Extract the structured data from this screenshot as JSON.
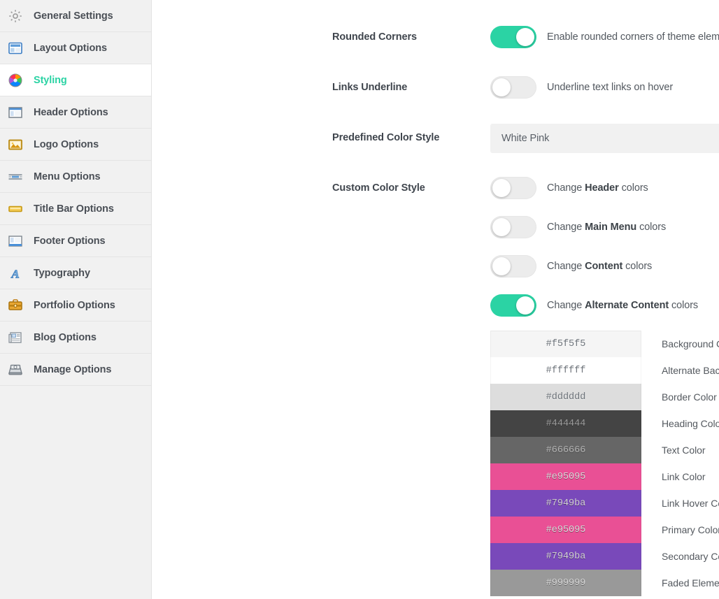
{
  "sidebar": {
    "items": [
      {
        "label": "General Settings",
        "icon": "gear-icon",
        "active": false
      },
      {
        "label": "Layout Options",
        "icon": "layout-icon",
        "active": false
      },
      {
        "label": "Styling",
        "icon": "color-wheel-icon",
        "active": true
      },
      {
        "label": "Header Options",
        "icon": "header-layout-icon",
        "active": false
      },
      {
        "label": "Logo Options",
        "icon": "image-icon",
        "active": false
      },
      {
        "label": "Menu Options",
        "icon": "menu-lines-icon",
        "active": false
      },
      {
        "label": "Title Bar Options",
        "icon": "title-bar-icon",
        "active": false
      },
      {
        "label": "Footer Options",
        "icon": "footer-layout-icon",
        "active": false
      },
      {
        "label": "Typography",
        "icon": "letter-a-icon",
        "active": false
      },
      {
        "label": "Portfolio Options",
        "icon": "briefcase-icon",
        "active": false
      },
      {
        "label": "Blog Options",
        "icon": "newspaper-icon",
        "active": false
      },
      {
        "label": "Manage Options",
        "icon": "disk-drive-icon",
        "active": false
      }
    ]
  },
  "main": {
    "rounded_corners": {
      "label": "Rounded Corners",
      "toggle_on": true,
      "description": "Enable rounded corners of theme elements"
    },
    "links_underline": {
      "label": "Links Underline",
      "toggle_on": false,
      "description": "Underline text links on hover"
    },
    "predefined_color_style": {
      "label": "Predefined Color Style",
      "value": "White Pink",
      "chevron": "chevron-down-icon"
    },
    "custom_color_style": {
      "label": "Custom Color Style",
      "toggles": [
        {
          "prefix": "Change ",
          "strong": "Header",
          "suffix": " colors",
          "on": false
        },
        {
          "prefix": "Change ",
          "strong": "Main Menu",
          "suffix": " colors",
          "on": false
        },
        {
          "prefix": "Change ",
          "strong": "Content",
          "suffix": " colors",
          "on": false
        },
        {
          "prefix": "Change ",
          "strong": "Alternate Content",
          "suffix": " colors",
          "on": true
        }
      ]
    },
    "colors": [
      {
        "hex": "#f5f5f5",
        "label": "Background Color",
        "text_color": "#6d737a"
      },
      {
        "hex": "#ffffff",
        "label": "Alternate Background Color",
        "text_color": "#6d737a"
      },
      {
        "hex": "#dddddd",
        "label": "Border Color",
        "text_color": "#6d737a"
      },
      {
        "hex": "#444444",
        "label": "Heading Color",
        "text_color": "#9a9a9a"
      },
      {
        "hex": "#666666",
        "label": "Text Color",
        "text_color": "#b5b5b5"
      },
      {
        "hex": "#e95095",
        "label": "Link Color",
        "text_color": "#d8d8d8"
      },
      {
        "hex": "#7949ba",
        "label": "Link Hover Color",
        "text_color": "#cfcfcf"
      },
      {
        "hex": "#e95095",
        "label": "Primary Color",
        "text_color": "#d8d8d8"
      },
      {
        "hex": "#7949ba",
        "label": "Secondary Color",
        "text_color": "#cfcfcf"
      },
      {
        "hex": "#999999",
        "label": "Faded Elements Color",
        "text_color": "#d6d6d6"
      }
    ]
  },
  "theme": {
    "accent": "#2bd3a4",
    "sidebar_bg": "#f1f1f1",
    "active_text": "#2bd3a4"
  }
}
